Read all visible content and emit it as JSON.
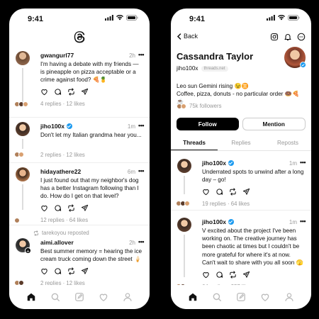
{
  "left": {
    "status_time": "9:41",
    "posts": [
      {
        "username": "gwangurl77",
        "verified": false,
        "time": "2h",
        "text": "I'm having a debate with my friends — is pineapple on pizza acceptable or a crime against food? 🍕🍍",
        "stats": "4 replies · 12 likes"
      },
      {
        "username": "jiho100x",
        "verified": true,
        "time": "1m",
        "text": "Don't let my Italian grandma hear you...",
        "stats": "2 replies · 12 likes"
      },
      {
        "username": "hidayathere22",
        "verified": false,
        "time": "6m",
        "text": "I just found out that my neighbor's dog has a better Instagram following than I do. How do I get on that level?",
        "stats": "12 replies · 64 likes"
      },
      {
        "repost_by": "tarekoyou reposted",
        "username": "aimi.allover",
        "verified": false,
        "time": "2h",
        "text": "Best summer memory = hearing the ice cream truck coming down the street 🍦",
        "stats": "2 replies · 12 likes"
      }
    ]
  },
  "right": {
    "status_time": "9:41",
    "back_label": "Back",
    "profile": {
      "name": "Cassandra Taylor",
      "handle": "jiho100x",
      "domain_chip": "threads.net",
      "bio_line1": "Leo sun Gemini rising 😉♊",
      "bio_line2": "Coffee, pizza, donuts - no particular order 🍩🍕☕",
      "followers": "75k followers"
    },
    "buttons": {
      "follow": "Follow",
      "mention": "Mention"
    },
    "tabs": [
      "Threads",
      "Replies",
      "Reposts"
    ],
    "posts": [
      {
        "username": "jiho100x",
        "verified": true,
        "time": "1m",
        "text": "Underrated spots to unwind after a long day – go!",
        "stats": "19 replies · 64 likes"
      },
      {
        "username": "jiho100x",
        "verified": true,
        "time": "1m",
        "text": "V excited about the project I've been working on. The creative journey has been chaotic at times but I couldn't be more grateful for where it's at now. Can't wait to share with you all soon 🫣",
        "stats": "64 replies · 357 likes"
      }
    ]
  },
  "colors": {
    "verified": "#1d9bf0",
    "muted": "#999999",
    "follow_bg": "#000000"
  },
  "icons": [
    "threads-logo",
    "heart",
    "comment",
    "repost",
    "share",
    "home",
    "search",
    "compose",
    "activity",
    "profile",
    "instagram",
    "bell",
    "more"
  ]
}
